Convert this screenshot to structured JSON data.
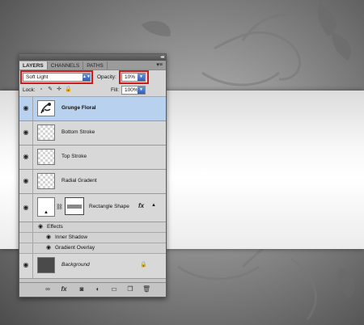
{
  "panel": {
    "tabs": [
      {
        "label": "LAYERS"
      },
      {
        "label": "CHANNELS"
      },
      {
        "label": "PATHS"
      }
    ],
    "collapse_glyph": "◂◂",
    "menu_glyph": "▾≡",
    "blend_mode": "Soft Light",
    "opacity_label": "Opacity:",
    "opacity_value": "10%",
    "lock_label": "Lock:",
    "fill_label": "Fill:",
    "fill_value": "100%"
  },
  "layers": [
    {
      "name": "Grunge Floral",
      "selected": true,
      "visible": true
    },
    {
      "name": "Bottom Stroke",
      "selected": false,
      "visible": true
    },
    {
      "name": "Top Stroke",
      "selected": false,
      "visible": true
    },
    {
      "name": "Radial Gradent",
      "selected": false,
      "visible": true
    },
    {
      "name": "Rectangle Shape",
      "selected": false,
      "visible": true,
      "has_fx": true,
      "fx_label": "fx"
    },
    {
      "name": "Background",
      "selected": false,
      "visible": true,
      "locked": true
    }
  ],
  "effects": {
    "header": "Effects",
    "items": [
      "Inner Shadow",
      "Gradient Overlay"
    ]
  },
  "highlight_color": "#d21a1a",
  "selection_color": "#b7d1ef",
  "icons": {
    "eye": "eye-icon",
    "lock_transparent": "lock-transparent-icon",
    "lock_paint": "lock-paint-icon",
    "lock_move": "lock-move-icon",
    "lock_all": "lock-all-icon",
    "bottom_bar": [
      "link-layers-icon",
      "fx-icon",
      "add-mask-icon",
      "adjustment-layer-icon",
      "new-group-icon",
      "new-layer-icon",
      "trash-icon"
    ]
  }
}
